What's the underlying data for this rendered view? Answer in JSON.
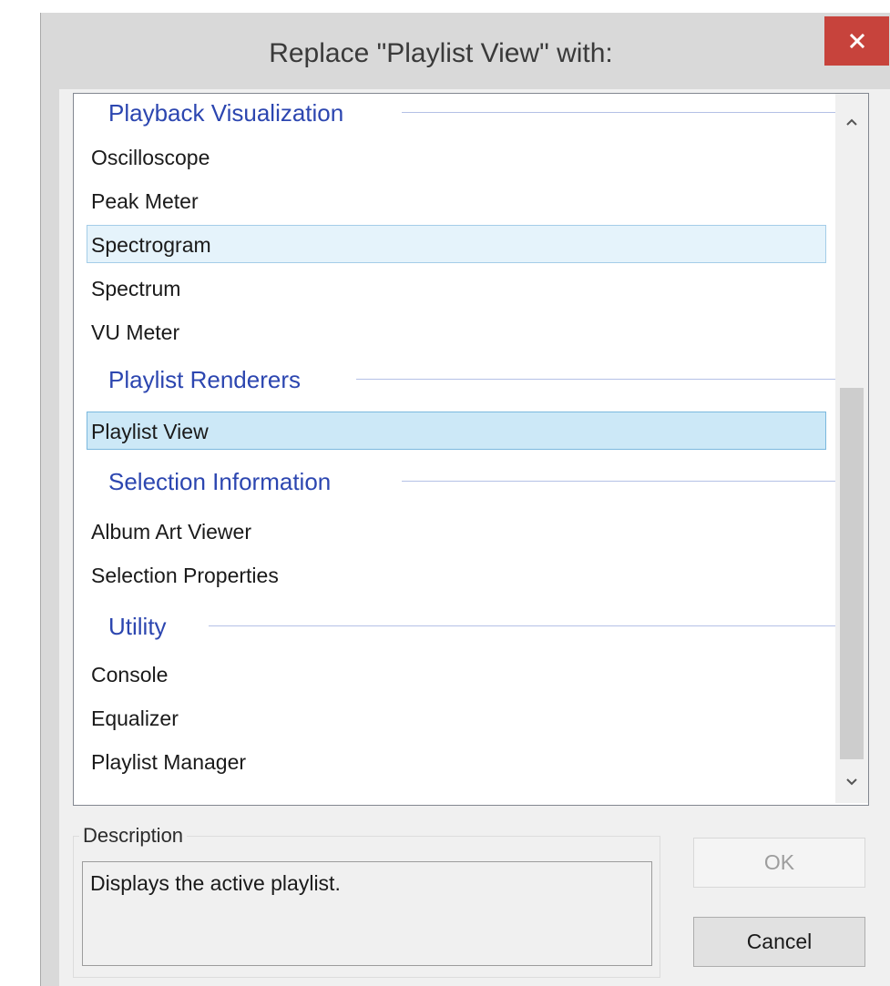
{
  "dialog": {
    "title": "Replace \"Playlist View\" with:",
    "close_icon": "close-icon"
  },
  "list": {
    "groups": [
      {
        "label": "Playback Visualization",
        "items": [
          "Oscilloscope",
          "Peak Meter",
          "Spectrogram",
          "Spectrum",
          "VU Meter"
        ]
      },
      {
        "label": "Playlist Renderers",
        "items": [
          "Playlist View"
        ]
      },
      {
        "label": "Selection Information",
        "items": [
          "Album Art Viewer",
          "Selection Properties"
        ]
      },
      {
        "label": "Utility",
        "items": [
          "Console",
          "Equalizer",
          "Playlist Manager"
        ]
      }
    ],
    "selected_item": "Playlist View",
    "hover_item": "Spectrogram"
  },
  "scrollbar": {
    "up_icon": "chevron-up-icon",
    "down_icon": "chevron-down-icon"
  },
  "description": {
    "legend": "Description",
    "text": "Displays the active playlist."
  },
  "buttons": {
    "ok_label": "OK",
    "cancel_label": "Cancel"
  },
  "colors": {
    "close_button": "#c7433c",
    "group_header": "#2c46b0",
    "selection": "#cce8f7"
  }
}
